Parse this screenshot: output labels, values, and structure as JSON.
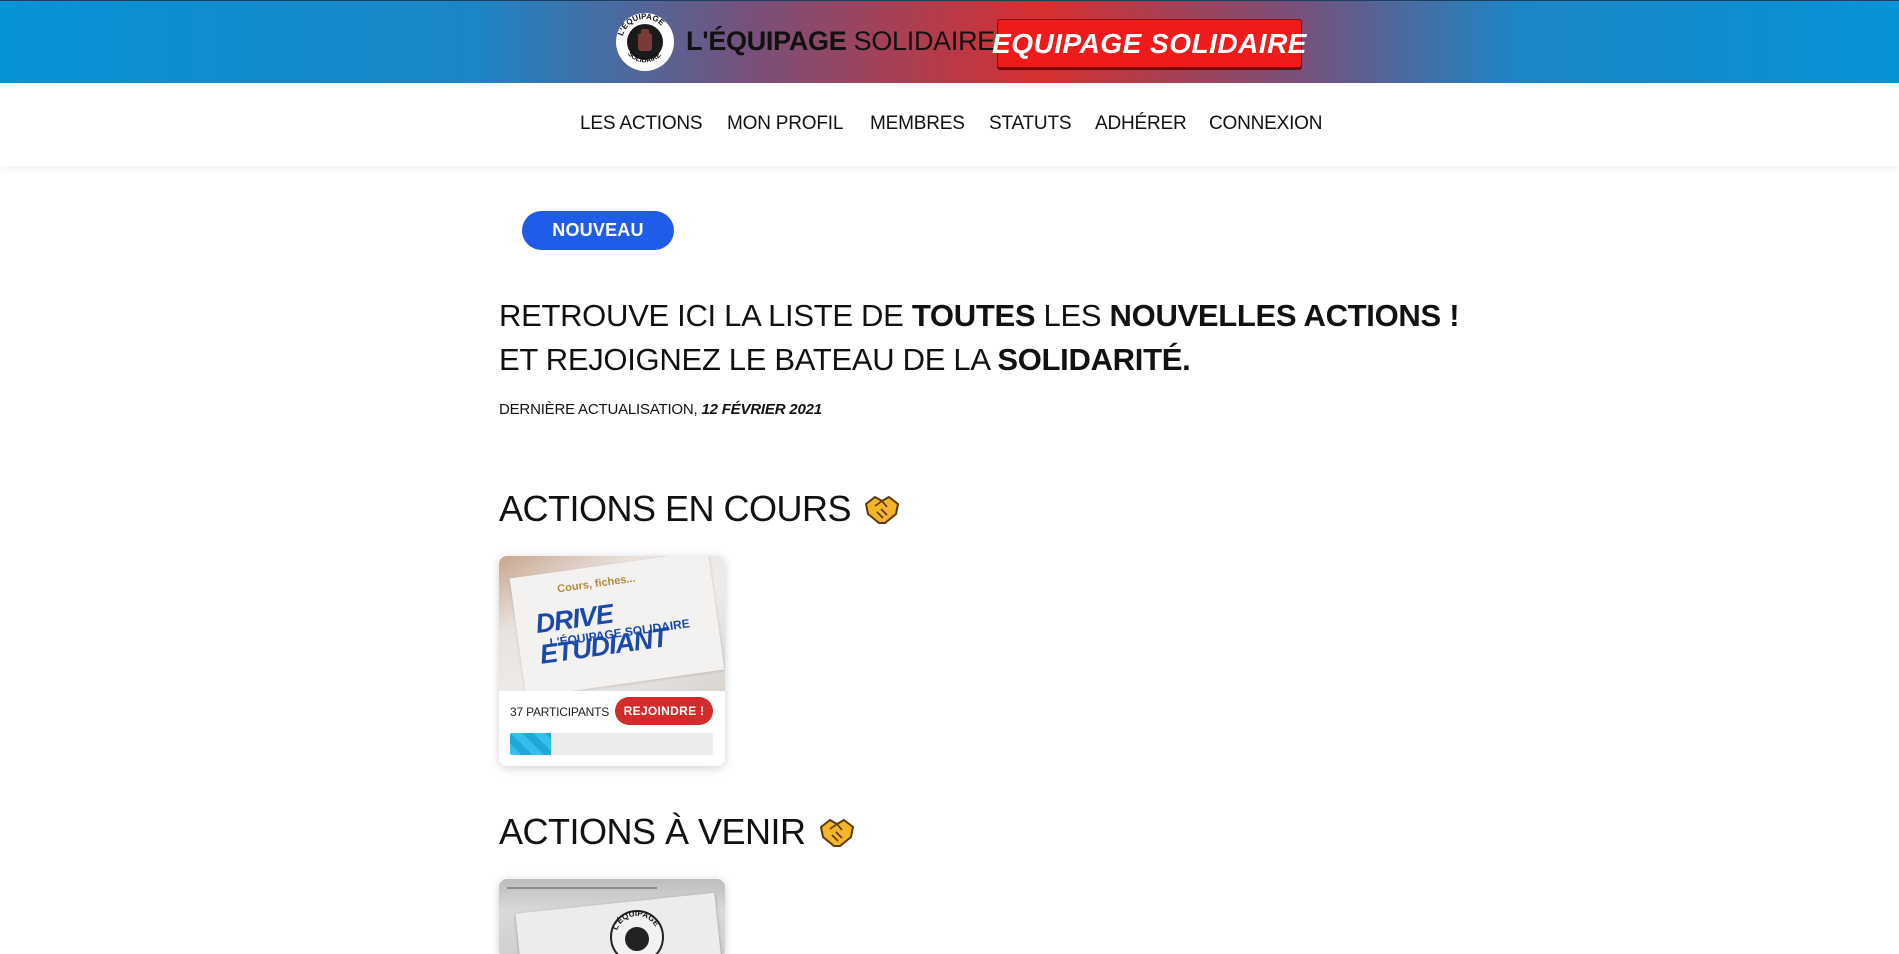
{
  "header": {
    "brand_bold": "L'ÉQUIPAGE",
    "brand_light": "SOLIDAIRE",
    "logo_text_top": "L'ÉQUIPAGE",
    "logo_text_bottom": "SOLIDAIRE",
    "cta_label": "EQUIPAGE SOLIDAIRE",
    "colors": {
      "blue": "#0693d8",
      "red": "#d82f2f",
      "cta": "#ef1a1a"
    }
  },
  "nav": {
    "items": [
      {
        "label": "LES ACTIONS"
      },
      {
        "label": "MON PROFIL"
      },
      {
        "label": "MEMBRES"
      },
      {
        "label": "STATUTS"
      },
      {
        "label": "ADHÉRER"
      },
      {
        "label": "CONNEXION"
      }
    ]
  },
  "main": {
    "badge": "NOUVEAU",
    "headline": {
      "l1_a": "RETROUVE ICI LA LISTE DE ",
      "l1_b": "TOUTES",
      "l1_c": " LES ",
      "l1_d": "NOUVELLES ACTIONS !",
      "l2_a": "ET REJOIGNEZ LE BATEAU DE LA ",
      "l2_b": "SOLIDARITÉ."
    },
    "update_label": "DERNIÈRE ACTUALISATION, ",
    "update_date": "12 FÉVRIER 2021",
    "sections": [
      {
        "title": "ACTIONS EN COURS",
        "emoji": "handshake-icon",
        "cards": [
          {
            "image_text_small": "Cours, fiches...",
            "image_text_big": "DRIVE ETUDIANT",
            "image_text_sub": "L'ÉQUIPAGE SOLIDAIRE",
            "participants": "37 PARTICIPANTS",
            "join_label": "REJOINDRE !",
            "progress": 0.2
          }
        ]
      },
      {
        "title": "ACTIONS À VENIR",
        "emoji": "handshake-icon",
        "cards": [
          {
            "image_text": "L'ÉQUIPAGE"
          }
        ]
      }
    ]
  }
}
